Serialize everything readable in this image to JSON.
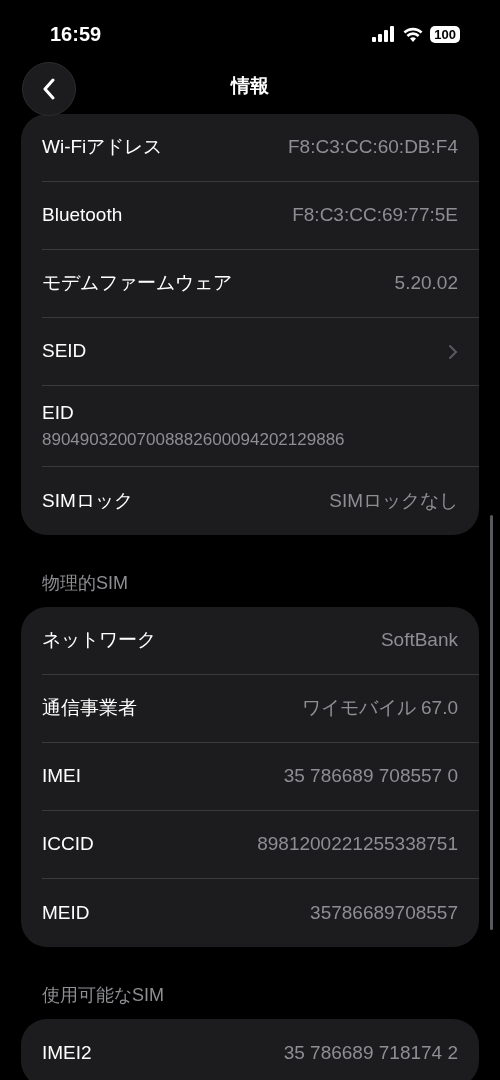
{
  "status_bar": {
    "time": "16:59",
    "battery": "100"
  },
  "nav": {
    "title": "情報"
  },
  "sections": [
    {
      "rows": [
        {
          "kind": "value",
          "label": "Wi-Fiアドレス",
          "value": "F8:C3:CC:60:DB:F4"
        },
        {
          "kind": "value",
          "label": "Bluetooth",
          "value": "F8:C3:CC:69:77:5E"
        },
        {
          "kind": "value",
          "label": "モデムファームウェア",
          "value": "5.20.02"
        },
        {
          "kind": "link",
          "label": "SEID"
        },
        {
          "kind": "stacked",
          "label": "EID",
          "value": "89049032007008882600094202129886"
        },
        {
          "kind": "value",
          "label": "SIMロック",
          "value": "SIMロックなし"
        }
      ]
    },
    {
      "header": "物理的SIM",
      "rows": [
        {
          "kind": "value",
          "label": "ネットワーク",
          "value": "SoftBank"
        },
        {
          "kind": "value",
          "label": "通信事業者",
          "value": "ワイモバイル 67.0"
        },
        {
          "kind": "value",
          "label": "IMEI",
          "value": "35 786689 708557 0"
        },
        {
          "kind": "value",
          "label": "ICCID",
          "value": "8981200221255338751"
        },
        {
          "kind": "value",
          "label": "MEID",
          "value": "35786689708557"
        }
      ]
    },
    {
      "header": "使用可能なSIM",
      "rows": [
        {
          "kind": "value",
          "label": "IMEI2",
          "value": "35 786689 718174 2"
        }
      ]
    }
  ]
}
